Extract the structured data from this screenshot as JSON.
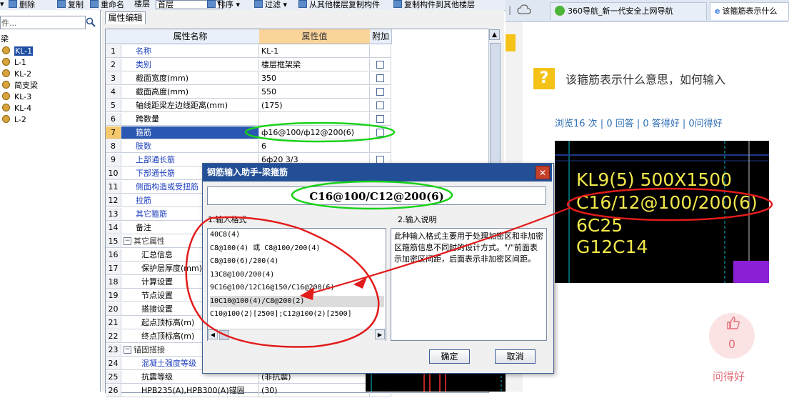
{
  "toolbar": {
    "items": [
      "▾",
      "删除",
      "复制",
      "重命名",
      "楼层",
      "首层",
      "排序 ▾",
      "过滤 ▾",
      "从其他楼层复制构件",
      "复制构件到其他楼层"
    ]
  },
  "tree": {
    "search_placeholder": "件...",
    "search_icon": "magnifier-icon",
    "root_label": "梁",
    "items": [
      "KL-1",
      "L-1",
      "KL-2",
      "简支梁",
      "KL-3",
      "KL-4",
      "L-2"
    ],
    "selected": "KL-1"
  },
  "prop_panel": {
    "tab_label": "属性编辑",
    "headers": [
      "属性名称",
      "属性值",
      "附加"
    ],
    "rows": [
      {
        "num": "1",
        "name": "名称",
        "value": "KL-1"
      },
      {
        "num": "2",
        "name": "类别",
        "value": "楼层框架梁"
      },
      {
        "num": "3",
        "name": "截面宽度(mm)",
        "value": "350"
      },
      {
        "num": "4",
        "name": "截面高度(mm)",
        "value": "550"
      },
      {
        "num": "5",
        "name": "轴线距梁左边线距离(mm)",
        "value": "(175)"
      },
      {
        "num": "6",
        "name": "跨数量",
        "value": ""
      },
      {
        "num": "7",
        "name": "箍筋",
        "value": "ф16@100/ф12@200(6)"
      },
      {
        "num": "8",
        "name": "肢数",
        "value": "6"
      },
      {
        "num": "9",
        "name": "上部通长筋",
        "value": "6ф20 3/3"
      },
      {
        "num": "10",
        "name": "下部通长筋",
        "value": ""
      },
      {
        "num": "11",
        "name": "侧面构造或受扭筋",
        "value": ""
      },
      {
        "num": "12",
        "name": "拉筋",
        "value": ""
      },
      {
        "num": "13",
        "name": "其它箍筋",
        "value": ""
      },
      {
        "num": "14",
        "name": "备注",
        "value": ""
      },
      {
        "num": "15",
        "name": "其它属性",
        "value": ""
      },
      {
        "num": "16",
        "name": "汇总信息",
        "value": ""
      },
      {
        "num": "17",
        "name": "保护层厚度(mm)",
        "value": ""
      },
      {
        "num": "18",
        "name": "计算设置",
        "value": ""
      },
      {
        "num": "19",
        "name": "节点设置",
        "value": ""
      },
      {
        "num": "20",
        "name": "搭接设置",
        "value": ""
      },
      {
        "num": "21",
        "name": "起点顶标高(m)",
        "value": ""
      },
      {
        "num": "22",
        "name": "终点顶标高(m)",
        "value": ""
      },
      {
        "num": "23",
        "name": "锚固搭接",
        "value": ""
      },
      {
        "num": "24",
        "name": "混凝土强度等级",
        "value": ""
      },
      {
        "num": "25",
        "name": "抗震等级",
        "value": "(非抗震)"
      },
      {
        "num": "26",
        "name": "HPB235(A),HPB300(A)锚固",
        "value": "(30)"
      }
    ]
  },
  "dialog": {
    "title": "钢筋输入助手-梁箍筋",
    "input_value": "C16@100/C12@200(6)",
    "section1_label": "1.输入格式",
    "section2_label": "2.输入说明",
    "formats": [
      "40C8(4)",
      "C8@100(4) 或 C8@100/200(4)",
      "C8@100(6)/200(4)",
      "13C8@100/200(4)",
      "9C16@100/12C16@150/C16@200(6)",
      "10C10@100(4)/C8@200(2)",
      "C10@100(2)[2500];C12@100(2)[2500]"
    ],
    "selected_format_index": 5,
    "description": "此种输入格式主要用于处理加密区和非加密区箍筋信息不同时的设计方式。\"/\"前面表示加密区间距，后面表示非加密区间距。",
    "ok_label": "确定",
    "cancel_label": "取消"
  },
  "browser": {
    "tabs": [
      "360导航_新一代安全上网导航",
      "该箍筋表示什么"
    ],
    "question_title": "该箍筋表示什么意思，如何输入",
    "stats": "浏览16 次 | 0 回答 | 0 答得好 | 0问得好",
    "image_lines": [
      "KL9(5) 500X1500",
      "C16/12@100/200(6)",
      "6C25",
      "G12C14"
    ],
    "like_count": "0",
    "ask_good_label": "问得好"
  },
  "colors": {
    "annotation_red": "#e21b1b",
    "annotation_green": "#19d219",
    "cad_yellow": "#f2e84a",
    "selection_blue": "#2a57b1",
    "header_orange": "#fbd49a"
  }
}
